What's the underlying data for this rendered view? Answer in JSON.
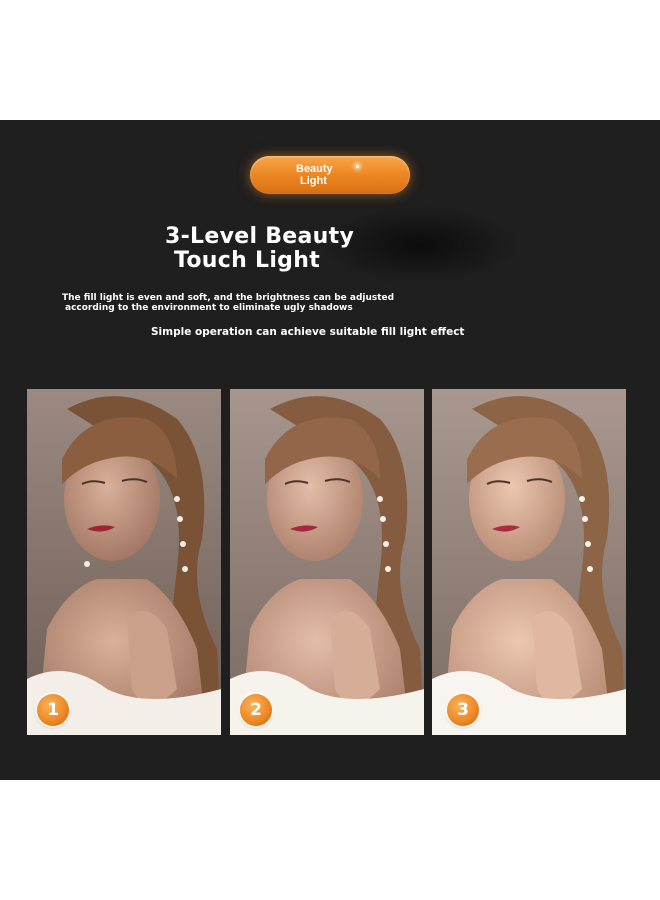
{
  "badge": {
    "line1": "Beauty",
    "line2": "Light"
  },
  "heading": {
    "line1": "3-Level Beauty",
    "line2": "Touch Light"
  },
  "description": {
    "line1": "The fill light is even and soft, and the brightness can be adjusted",
    "line2": "according to the environment to eliminate ugly shadows"
  },
  "subheading": "Simple operation can achieve suitable fill light effect",
  "levels": [
    {
      "number": "1",
      "brightness_level": 1
    },
    {
      "number": "2",
      "brightness_level": 2
    },
    {
      "number": "3",
      "brightness_level": 3
    }
  ],
  "colors": {
    "background": "#1f1f1f",
    "accent": "#ee8a26",
    "text": "#ffffff"
  }
}
